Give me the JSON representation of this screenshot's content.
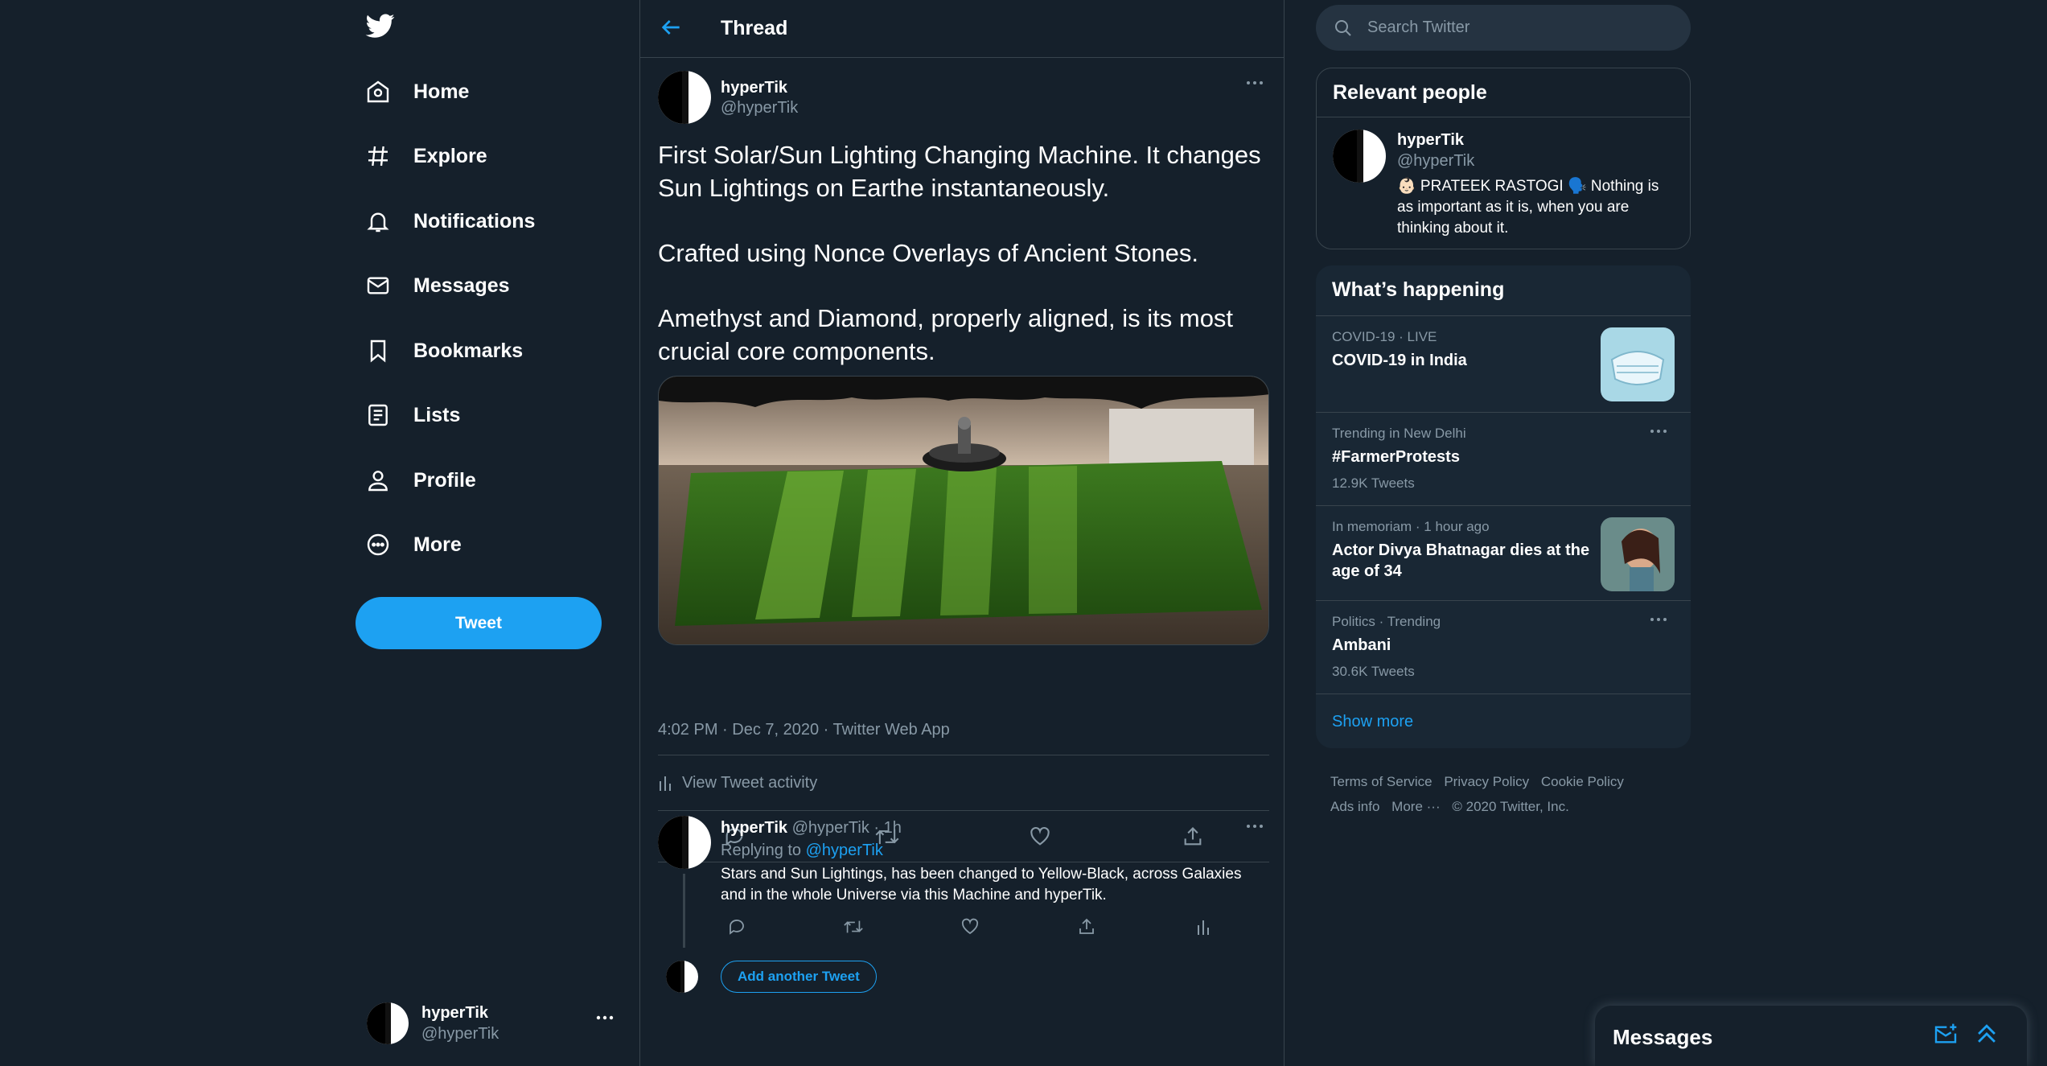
{
  "nav": {
    "items": [
      {
        "label": "Home",
        "icon": "home-icon"
      },
      {
        "label": "Explore",
        "icon": "hashtag-icon"
      },
      {
        "label": "Notifications",
        "icon": "bell-icon"
      },
      {
        "label": "Messages",
        "icon": "envelope-icon"
      },
      {
        "label": "Bookmarks",
        "icon": "bookmark-icon"
      },
      {
        "label": "Lists",
        "icon": "list-icon"
      },
      {
        "label": "Profile",
        "icon": "person-icon"
      },
      {
        "label": "More",
        "icon": "more-circle-icon"
      }
    ],
    "tweet_button": "Tweet",
    "account": {
      "name": "hyperTik",
      "handle": "@hyperTik"
    }
  },
  "header": {
    "title": "Thread"
  },
  "tweet": {
    "name": "hyperTik",
    "handle": "@hyperTik",
    "paragraphs": [
      "First Solar/Sun Lighting Changing Machine. It changes Sun Lightings on Earthe instantaneously.",
      "Crafted using Nonce Overlays of Ancient Stones.",
      "Amethyst and Diamond, properly aligned, is its most crucial core components."
    ],
    "meta": "4:02 PM · Dec 7, 2020 · Twitter Web App",
    "activity": "View Tweet activity"
  },
  "reply": {
    "name": "hyperTik",
    "handle_time": "@hyperTik · 1h",
    "replying_prefix": "Replying to",
    "replying_to": "@hyperTik",
    "text": "Stars and Sun Lightings, has been changed to Yellow-Black, across Galaxies and in the whole Universe via this Machine and hyperTik.",
    "add_another": "Add another Tweet"
  },
  "search": {
    "placeholder": "Search Twitter"
  },
  "relevant_people": {
    "title": "Relevant people",
    "name": "hyperTik",
    "handle": "@hyperTik",
    "bio": "👶🏻 PRATEEK RASTOGI 🗣️ Nothing is as important as it is, when you are thinking about it."
  },
  "whats_happening": {
    "title": "What’s happening",
    "trends": [
      {
        "context": "COVID-19 · LIVE",
        "name": "COVID-19 in India",
        "count": ""
      },
      {
        "context": "Trending in New Delhi",
        "name": "#FarmerProtests",
        "count": "12.9K Tweets"
      },
      {
        "context": "In memoriam · 1 hour ago",
        "name": "Actor Divya Bhatnagar dies at the age of 34",
        "count": ""
      },
      {
        "context": "Politics · Trending",
        "name": "Ambani",
        "count": "30.6K Tweets"
      }
    ],
    "show_more": "Show more"
  },
  "footer": {
    "links": [
      "Terms of Service",
      "Privacy Policy",
      "Cookie Policy",
      "Ads info",
      "More ···"
    ],
    "copyright": "© 2020 Twitter, Inc."
  },
  "messages_drawer": {
    "title": "Messages"
  },
  "colors": {
    "background": "#15202b",
    "accent": "#1da1f2",
    "muted": "#8899a6",
    "border": "#38444d"
  }
}
